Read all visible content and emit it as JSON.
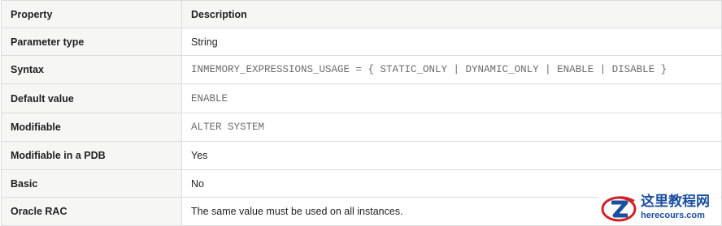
{
  "table": {
    "headers": {
      "property": "Property",
      "description": "Description"
    },
    "rows": [
      {
        "property": "Parameter type",
        "value": "String",
        "mono": false
      },
      {
        "property": "Syntax",
        "value": "INMEMORY_EXPRESSIONS_USAGE = { STATIC_ONLY | DYNAMIC_ONLY | ENABLE | DISABLE }",
        "mono": true
      },
      {
        "property": "Default value",
        "value": "ENABLE",
        "mono": true
      },
      {
        "property": "Modifiable",
        "value": "ALTER SYSTEM",
        "mono": true
      },
      {
        "property": "Modifiable in a PDB",
        "value": "Yes",
        "mono": false
      },
      {
        "property": "Basic",
        "value": "No",
        "mono": false
      },
      {
        "property": "Oracle RAC",
        "value": "The same value must be used on all instances.",
        "mono": false
      }
    ]
  },
  "watermark": {
    "title": "这里教程网",
    "domain": "herecours.com",
    "colors": {
      "primary": "#1c4fa0",
      "accent": "#d0202a"
    }
  }
}
